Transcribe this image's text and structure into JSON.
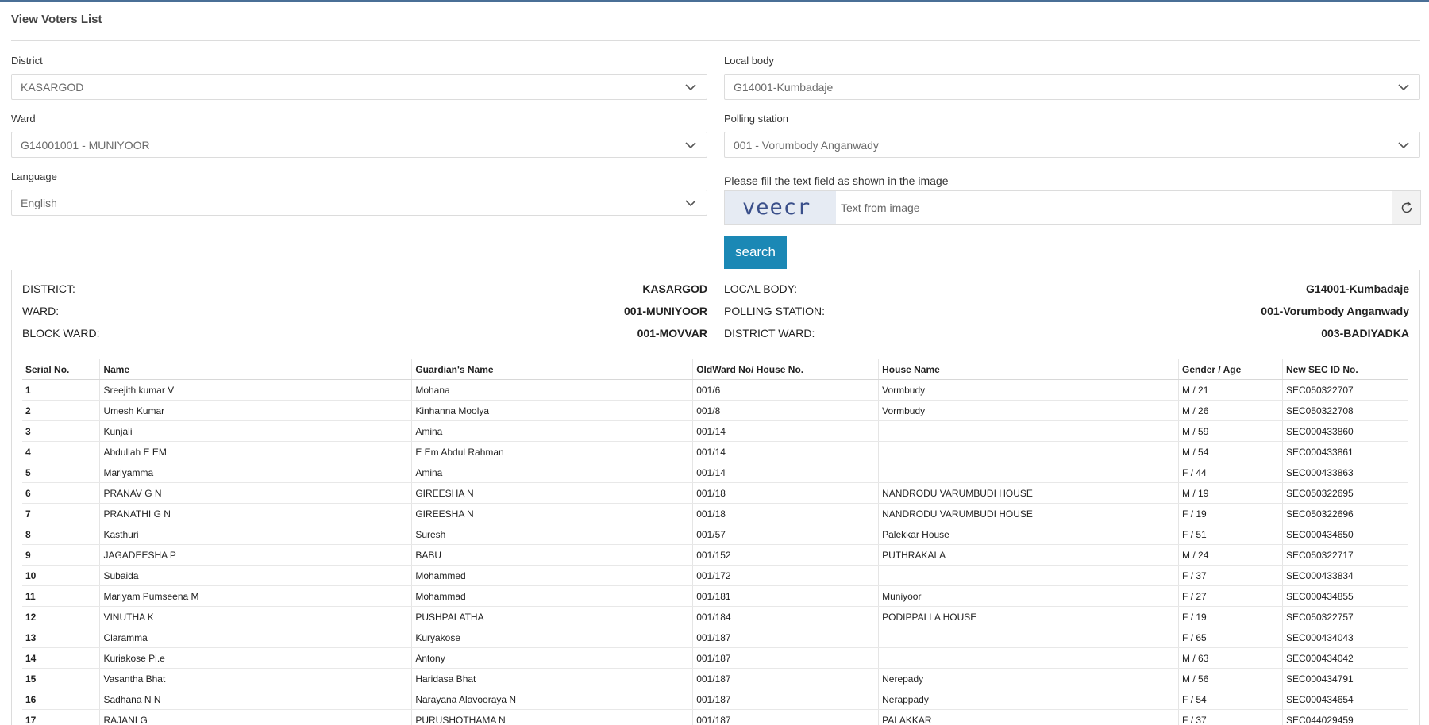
{
  "page": {
    "title": "View Voters List"
  },
  "filters": {
    "district": {
      "label": "District",
      "value": "KASARGOD"
    },
    "local_body": {
      "label": "Local body",
      "value": "G14001-Kumbadaje"
    },
    "ward": {
      "label": "Ward",
      "value": "G14001001 - MUNIYOOR"
    },
    "polling_station": {
      "label": "Polling station",
      "value": "001 - Vorumbody Anganwady"
    },
    "language": {
      "label": "Language",
      "value": "English"
    }
  },
  "captcha": {
    "label": "Please fill the text field as shown in the image",
    "image_text": "veecr",
    "placeholder": "Text from image"
  },
  "search": {
    "label": "search"
  },
  "summary": {
    "district_label": "DISTRICT:",
    "district_value": "KASARGOD",
    "ward_label": "WARD:",
    "ward_value": "001-MUNIYOOR",
    "block_ward_label": "BLOCK WARD:",
    "block_ward_value": "001-MOVVAR",
    "local_body_label": "LOCAL BODY:",
    "local_body_value": "G14001-Kumbadaje",
    "polling_station_label": "POLLING STATION:",
    "polling_station_value": "001-Vorumbody Anganwady",
    "district_ward_label": "DISTRICT WARD:",
    "district_ward_value": "003-BADIYADKA"
  },
  "table": {
    "columns": [
      "Serial No.",
      "Name",
      "Guardian's Name",
      "OldWard No/ House No.",
      "House Name",
      "Gender / Age",
      "New SEC ID No."
    ],
    "rows": [
      [
        "1",
        "Sreejith kumar V",
        "Mohana",
        "001/6",
        "Vormbudy",
        "M / 21",
        "SEC050322707"
      ],
      [
        "2",
        "Umesh Kumar",
        "Kinhanna Moolya",
        "001/8",
        "Vormbudy",
        "M / 26",
        "SEC050322708"
      ],
      [
        "3",
        "Kunjali",
        "Amina",
        "001/14",
        "",
        "M / 59",
        "SEC000433860"
      ],
      [
        "4",
        "Abdullah E EM",
        "E Em Abdul Rahman",
        "001/14",
        "",
        "M / 54",
        "SEC000433861"
      ],
      [
        "5",
        "Mariyamma",
        "Amina",
        "001/14",
        "",
        "F / 44",
        "SEC000433863"
      ],
      [
        "6",
        "PRANAV G N",
        "GIREESHA N",
        "001/18",
        "NANDRODU VARUMBUDI HOUSE",
        "M / 19",
        "SEC050322695"
      ],
      [
        "7",
        "PRANATHI G N",
        "GIREESHA N",
        "001/18",
        "NANDRODU VARUMBUDI HOUSE",
        "F / 19",
        "SEC050322696"
      ],
      [
        "8",
        "Kasthuri",
        "Suresh",
        "001/57",
        "Palekkar House",
        "F / 51",
        "SEC000434650"
      ],
      [
        "9",
        "JAGADEESHA P",
        "BABU",
        "001/152",
        "PUTHRAKALA",
        "M / 24",
        "SEC050322717"
      ],
      [
        "10",
        "Subaida",
        "Mohammed",
        "001/172",
        "",
        "F / 37",
        "SEC000433834"
      ],
      [
        "11",
        "Mariyam Pumseena M",
        "Mohammad",
        "001/181",
        "Muniyoor",
        "F / 27",
        "SEC000434855"
      ],
      [
        "12",
        "VINUTHA K",
        "PUSHPALATHA",
        "001/184",
        "PODIPPALLA HOUSE",
        "F / 19",
        "SEC050322757"
      ],
      [
        "13",
        "Claramma",
        "Kuryakose",
        "001/187",
        "",
        "F / 65",
        "SEC000434043"
      ],
      [
        "14",
        "Kuriakose Pi.e",
        "Antony",
        "001/187",
        "",
        "M / 63",
        "SEC000434042"
      ],
      [
        "15",
        "Vasantha Bhat",
        "Haridasa Bhat",
        "001/187",
        "Nerepady",
        "M / 56",
        "SEC000434791"
      ],
      [
        "16",
        "Sadhana N N",
        "Narayana Alavooraya N",
        "001/187",
        "Nerappady",
        "F / 54",
        "SEC000434654"
      ],
      [
        "17",
        "RAJANI G",
        "PURUSHOTHAMA N",
        "001/187",
        "PALAKKAR",
        "F / 37",
        "SEC044029459"
      ]
    ]
  }
}
